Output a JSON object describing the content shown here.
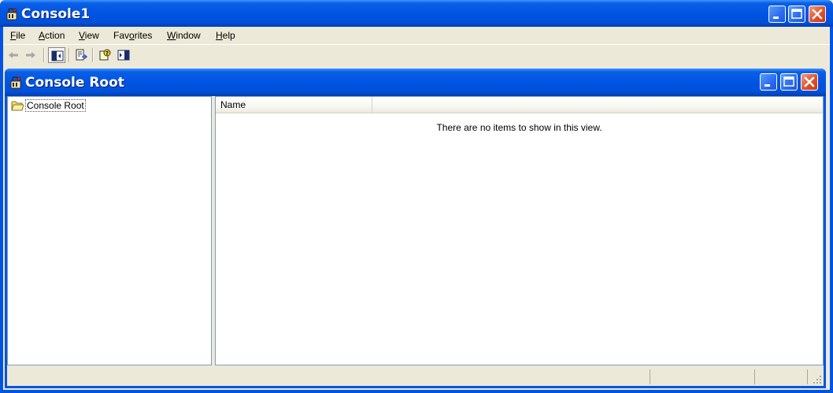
{
  "app": {
    "window_title": "Console1",
    "window_controls": [
      "minimize-icon",
      "maximize-icon",
      "close-icon"
    ]
  },
  "menu": [
    {
      "label": "File",
      "mnemonic": "F",
      "rest": "ile"
    },
    {
      "label": "Action",
      "mnemonic": "A",
      "rest": "ction"
    },
    {
      "label": "View",
      "mnemonic": "V",
      "rest": "iew"
    },
    {
      "label": "Favorites",
      "pre": "Fav",
      "mnemonic": "o",
      "rest": "rites"
    },
    {
      "label": "Window",
      "mnemonic": "W",
      "rest": "indow"
    },
    {
      "label": "Help",
      "mnemonic": "H",
      "rest": "elp"
    }
  ],
  "toolbar": {
    "icons": [
      "back-arrow-icon",
      "forward-arrow-icon",
      "show-hide-console-tree-icon",
      "export-list-icon",
      "help-icon",
      "show-hide-action-pane-icon"
    ]
  },
  "child_window": {
    "title": "Console Root"
  },
  "tree": {
    "items": [
      {
        "label": "Console Root",
        "icon": "folder-icon",
        "selected": true
      }
    ]
  },
  "list": {
    "columns": [
      "Name"
    ],
    "empty_message": "There are no items to show in this view."
  },
  "colors": {
    "title_bar": "#0054e3",
    "close_button": "#e0522c",
    "window_face": "#ece9d8",
    "pane_border": "#7f9db9"
  }
}
